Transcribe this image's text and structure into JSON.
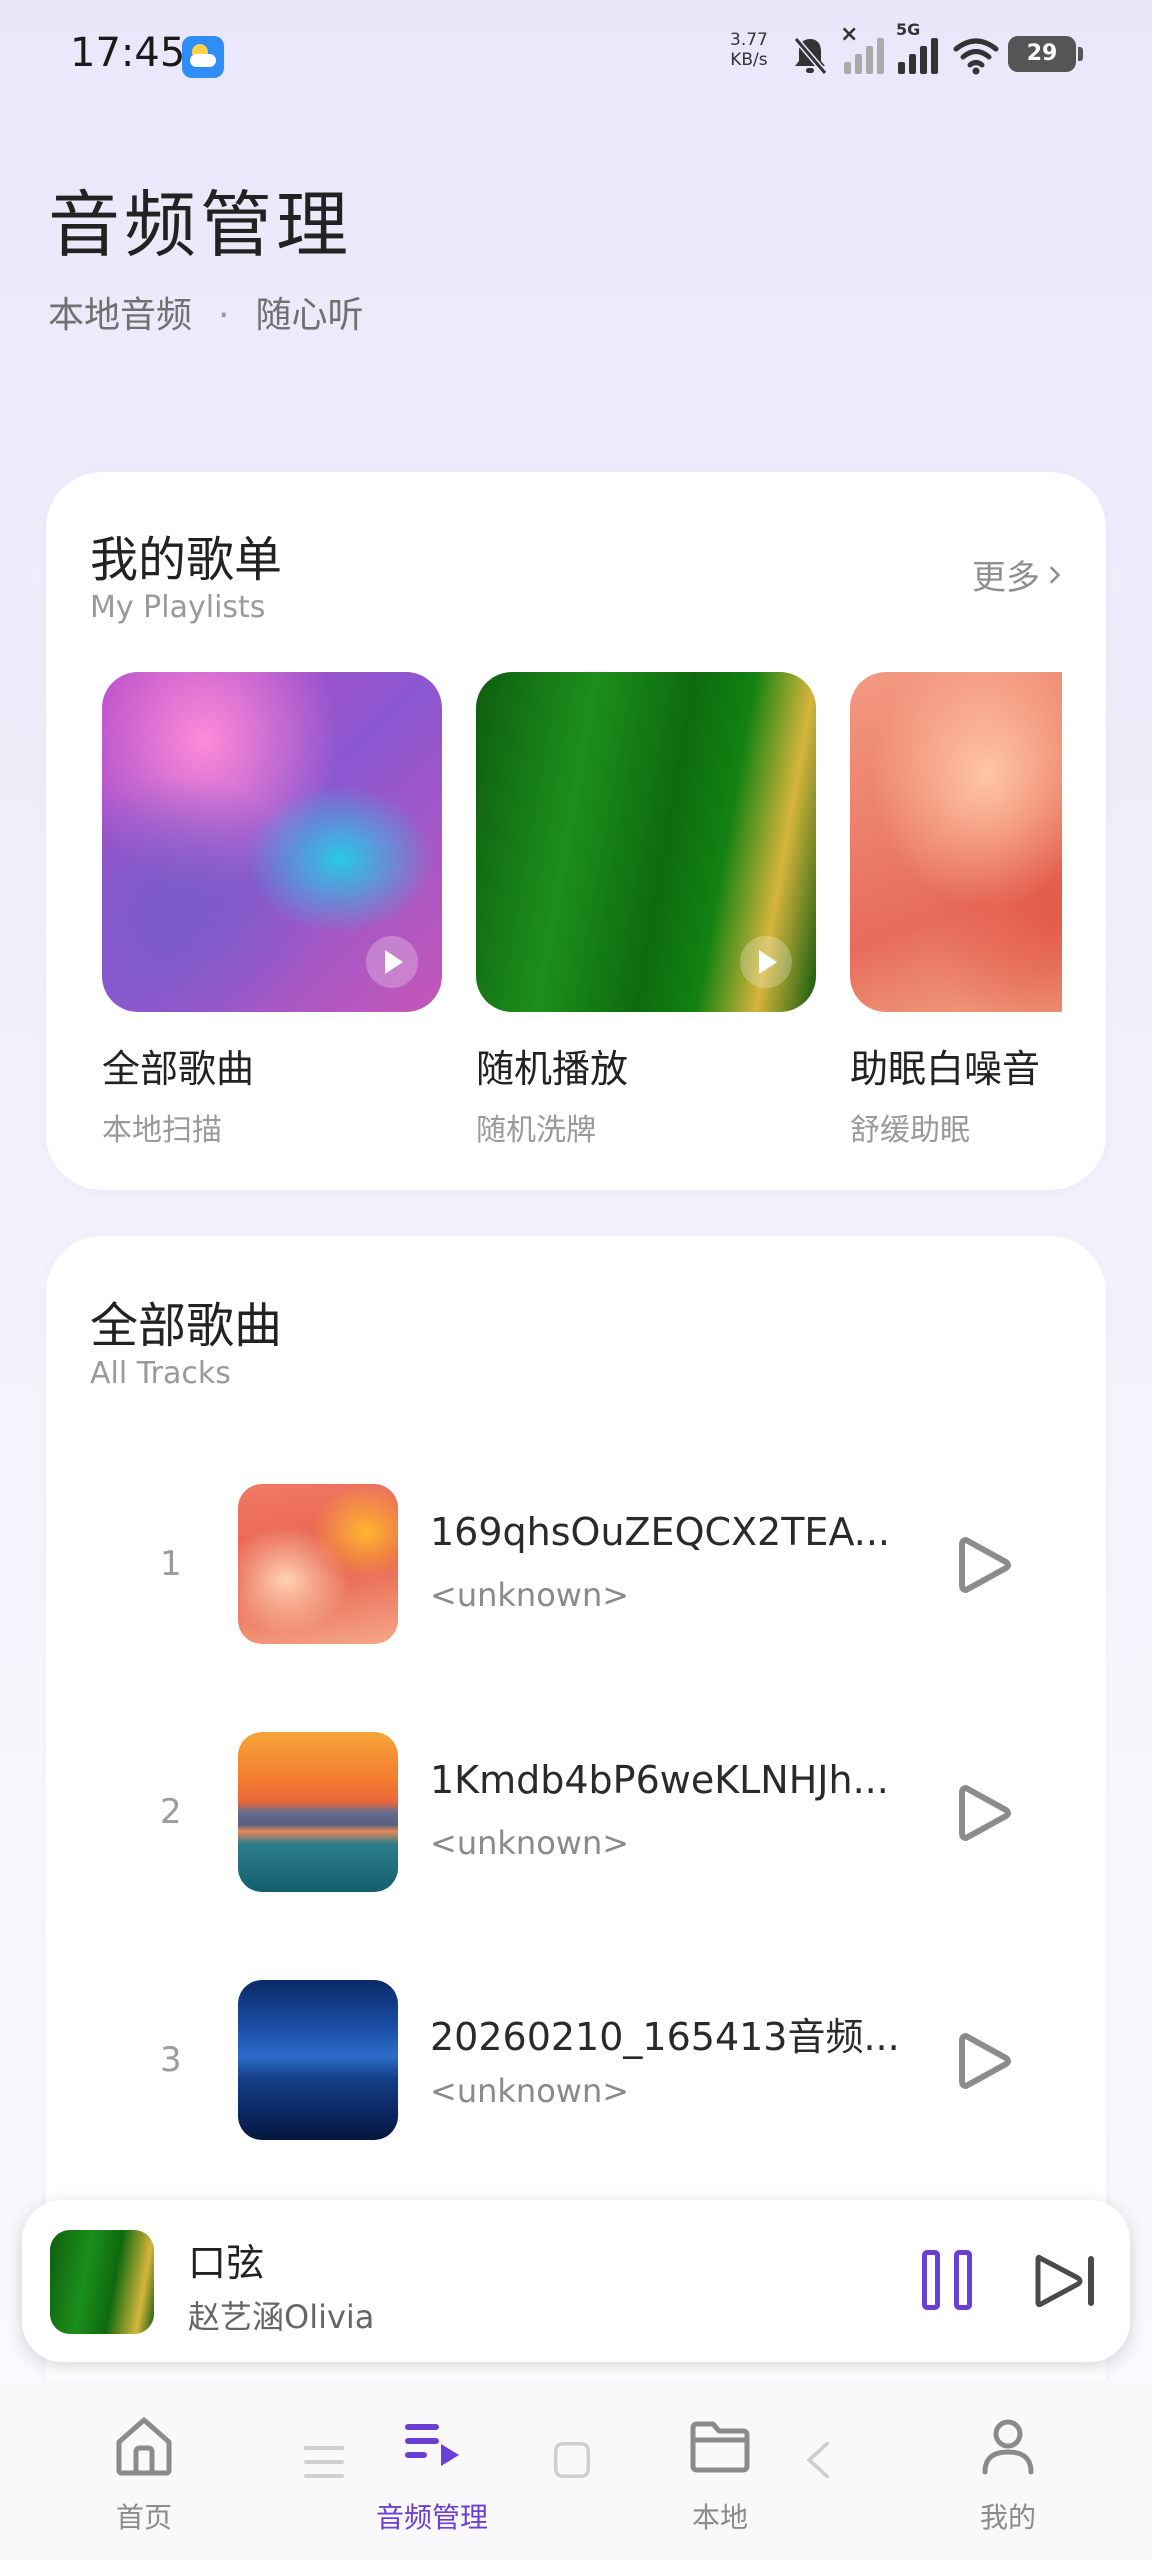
{
  "status_bar": {
    "time": "17:45",
    "net_speed_value": "3.77",
    "net_speed_unit": "KB/s",
    "network_type": "5G",
    "battery": "29"
  },
  "header": {
    "title": "音频管理",
    "subtitle_left": "本地音频",
    "subtitle_sep": "·",
    "subtitle_right": "随心听"
  },
  "playlists": {
    "title": "我的歌单",
    "subtitle": "My Playlists",
    "more_label": "更多",
    "items": [
      {
        "name": "全部歌曲",
        "desc": "本地扫描"
      },
      {
        "name": "随机播放",
        "desc": "随机洗牌"
      },
      {
        "name": "助眠白噪音",
        "desc": "舒缓助眠"
      }
    ]
  },
  "tracks": {
    "title": "全部歌曲",
    "subtitle": "All Tracks",
    "items": [
      {
        "index": "1",
        "title": "169qhsOuZEQCX2TEA...",
        "artist": "<unknown>"
      },
      {
        "index": "2",
        "title": "1Kmdb4bP6weKLNHJh...",
        "artist": "<unknown>"
      },
      {
        "index": "3",
        "title": "20260210_165413音频...",
        "artist": "<unknown>"
      }
    ]
  },
  "now_playing": {
    "title": "口弦",
    "artist": "赵艺涵Olivia"
  },
  "bottom_nav": {
    "items": [
      {
        "label": "首页",
        "icon": "home-icon"
      },
      {
        "label": "音频管理",
        "icon": "playlist-icon",
        "active": true
      },
      {
        "label": "本地",
        "icon": "folder-icon"
      },
      {
        "label": "我的",
        "icon": "profile-icon"
      }
    ]
  },
  "colors": {
    "accent": "#6b3fd6",
    "background_top": "#ebe7fb",
    "card": "#ffffff"
  }
}
